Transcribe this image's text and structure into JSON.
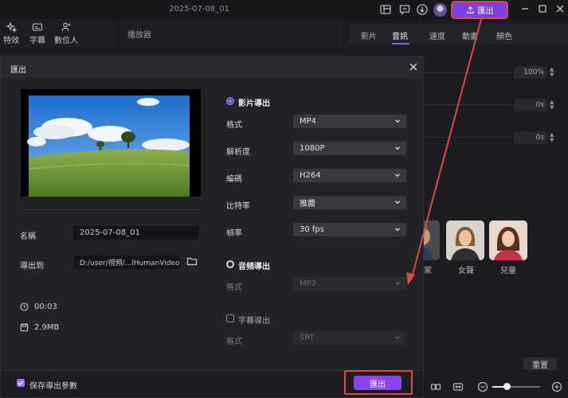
{
  "window": {
    "title": "2025-07-08_01",
    "export_label": "匯出"
  },
  "toolbar": {
    "tools": [
      {
        "label": "特效",
        "icon": "sparkle-icon"
      },
      {
        "label": "字幕",
        "icon": "subtitle-icon"
      },
      {
        "label": "數位人",
        "icon": "person-add-icon"
      }
    ]
  },
  "player": {
    "title": "播放器"
  },
  "right_panel": {
    "tabs": [
      "影片",
      "音訊",
      "速度",
      "動畫",
      "顏色"
    ],
    "active_tab": "音訊",
    "fields": [
      "100%",
      "0s",
      "0s"
    ],
    "avatar_labels": [
      "家",
      "女聲",
      "兒童"
    ],
    "reset_label": "重置"
  },
  "dialog": {
    "title": "匯出",
    "name_label": "名稱",
    "name_value": "2025-07-08_01",
    "export_to_label": "導出到",
    "export_path": "D:/user/視頻/...lHumanVideo",
    "duration": "00:03",
    "size": "2.9MB",
    "video_export": {
      "title": "影片導出",
      "selected": true,
      "rows": [
        {
          "label": "格式",
          "value": "MP4"
        },
        {
          "label": "解析度",
          "value": "1080P"
        },
        {
          "label": "編碼",
          "value": "H264"
        },
        {
          "label": "比特率",
          "value": "推薦"
        },
        {
          "label": "幀率",
          "value": "30  fps"
        }
      ]
    },
    "audio_export": {
      "title": "音頻導出",
      "selected": false,
      "format_label": "格式",
      "format_value": "MP3"
    },
    "subtitle_export": {
      "title": "字幕導出",
      "checked": false,
      "format_label": "格式",
      "format_value": "SRT"
    },
    "save_params_label": "保存導出參數",
    "save_params_checked": true,
    "export_button": "匯出"
  },
  "colors": {
    "accent": "#8b44f0",
    "annotation": "#e0473e",
    "background": "#1b1b1f"
  }
}
